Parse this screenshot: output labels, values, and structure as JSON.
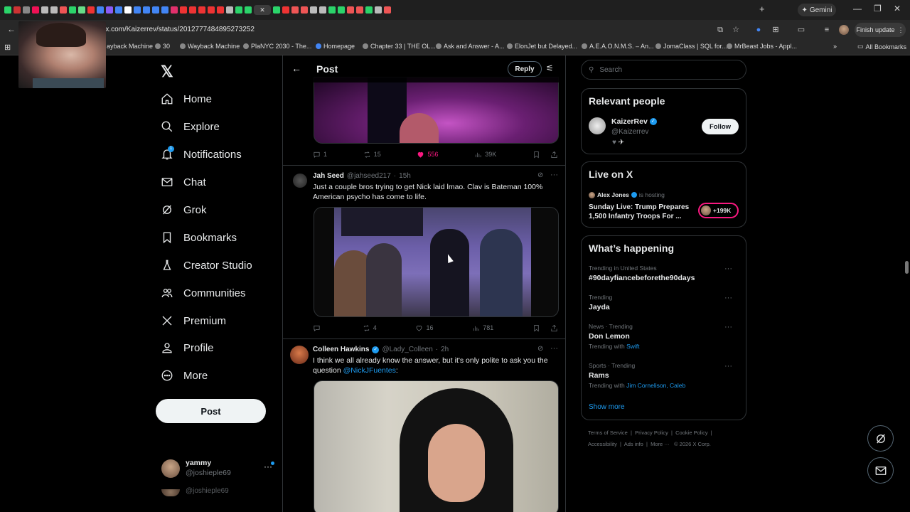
{
  "browser": {
    "url": "://x.com/Kaizerrev/status/2012777484895273252",
    "gemini_label": "Gemini",
    "finish_update_label": "Finish update",
    "tab_colors": [
      "#2bd46a",
      "#cc3333",
      "#888",
      "#e15",
      "#bbb",
      "#bbb",
      "#e55",
      "#2bd46a",
      "#6d8",
      "#e33",
      "#4285f4",
      "#8b5cf6",
      "#4285f4",
      "#fff",
      "#4285f4",
      "#4285f4",
      "#4285f4",
      "#4285f4",
      "#e1306c",
      "#e33",
      "#e33",
      "#e33",
      "#e33",
      "#e33",
      "#bbb",
      "#2bd46a",
      "#2bd46a",
      "#2bd46a",
      "#e33",
      "#e55",
      "#e55",
      "#bbb",
      "#bbb",
      "#2bd46a",
      "#2bd46a",
      "#e55",
      "#e55",
      "#2bd46a",
      "#bbb",
      "#e55"
    ],
    "bookmarks": [
      {
        "label": "ayback Machine"
      },
      {
        "label": "30"
      },
      {
        "label": "Wayback Machine"
      },
      {
        "label": "PlaNYC 2030 - The..."
      },
      {
        "label": "Homepage"
      },
      {
        "label": "Chapter 33 | THE OL..."
      },
      {
        "label": "Ask and Answer - A..."
      },
      {
        "label": "ElonJet but Delayed..."
      },
      {
        "label": "A.E.A.O.N.M.S. – An..."
      },
      {
        "label": "JomaClass | SQL for..."
      },
      {
        "label": "MrBeast Jobs - Appl..."
      },
      {
        "label": "All Bookmarks"
      }
    ]
  },
  "nav": {
    "items": [
      {
        "label": "Home",
        "icon": "home-icon"
      },
      {
        "label": "Explore",
        "icon": "search-icon"
      },
      {
        "label": "Notifications",
        "icon": "bell-icon"
      },
      {
        "label": "Chat",
        "icon": "mail-icon"
      },
      {
        "label": "Grok",
        "icon": "grok-icon"
      },
      {
        "label": "Bookmarks",
        "icon": "bookmark-icon"
      },
      {
        "label": "Creator Studio",
        "icon": "flask-icon"
      },
      {
        "label": "Communities",
        "icon": "people-icon"
      },
      {
        "label": "Premium",
        "icon": "x-logo-icon"
      },
      {
        "label": "Profile",
        "icon": "person-icon"
      },
      {
        "label": "More",
        "icon": "more-circle-icon"
      }
    ],
    "notification_badge": "1",
    "post_button": "Post",
    "account": {
      "name": "yammy",
      "handle": "@joshieple69"
    }
  },
  "post": {
    "title": "Post",
    "reply_button": "Reply",
    "tweet1_stats": {
      "replies": "1",
      "reposts": "15",
      "likes": "556",
      "views": "39K"
    },
    "tweet2": {
      "name": "Jah Seed",
      "handle": "@jahseed217",
      "time": "15h",
      "text": "Just a couple bros trying to get Nick laid lmao. Clav is Bateman 100% American psycho has come to life.",
      "stats": {
        "replies": "",
        "reposts": "4",
        "likes": "16",
        "views": "781"
      }
    },
    "tweet3": {
      "name": "Colleen Hawkins",
      "handle": "@Lady_Colleen",
      "time": "2h",
      "text_before": "I think we all already know the answer, but it's only polite to ask you the question ",
      "mention": "@NickJFuentes",
      "text_after": ":"
    }
  },
  "sidebar": {
    "search_placeholder": "Search",
    "relevant_title": "Relevant people",
    "person": {
      "name": "KaizerRev",
      "handle": "@Kaizerrev",
      "follow": "Follow"
    },
    "live_title": "Live on X",
    "live": {
      "host": "Alex Jones",
      "hosting": "is hosting",
      "title": "Sunday Live: Trump Prepares 1,500 Infantry Troops For ...",
      "count": "+199K"
    },
    "happening_title": "What’s happening",
    "trends": [
      {
        "meta": "Trending in United States",
        "title": "#90dayfiancebeforethe90days",
        "sub": "",
        "sub_links": ""
      },
      {
        "meta": "Trending",
        "title": "Jayda",
        "sub": "",
        "sub_links": ""
      },
      {
        "meta": "News · Trending",
        "title": "Don Lemon",
        "sub": "Trending with",
        "sub_links": "Swift"
      },
      {
        "meta": "Sports · Trending",
        "title": "Rams",
        "sub": "Trending with",
        "sub_links": "Jim Cornelison, Caleb"
      }
    ],
    "show_more": "Show more",
    "footer": {
      "terms": "Terms of Service",
      "privacy": "Privacy Policy",
      "cookie": "Cookie Policy",
      "accessibility": "Accessibility",
      "ads": "Ads info",
      "more": "More ···",
      "copyright": "© 2026 X Corp."
    }
  },
  "colors": {
    "accent": "#1d9bf0",
    "like": "#f91880",
    "bg": "#000000",
    "border": "#2f3336"
  }
}
